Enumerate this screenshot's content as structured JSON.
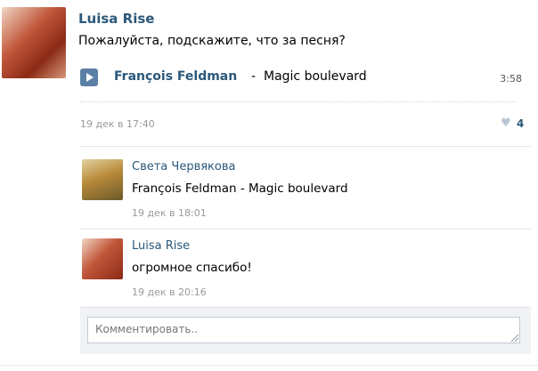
{
  "post": {
    "author": "Luisa Rise",
    "text": "Пожалуйста, подскажите, что за песня?",
    "audio": {
      "artist": "François Feldman",
      "separator": "-",
      "title": "Magic boulevard",
      "duration": "3:58"
    },
    "date": "19 дек в 17:40",
    "likes": "4"
  },
  "comments": [
    {
      "author": "Света Червякова",
      "text": "François Feldman - Magic boulevard",
      "date": "19 дек в 18:01"
    },
    {
      "author": "Luisa Rise",
      "text": "огромное спасибо!",
      "date": "19 дек в 20:16"
    }
  ],
  "comment_form": {
    "placeholder": "Комментировать.."
  },
  "icons": {
    "play": "play-icon",
    "like": "heart-icon"
  },
  "colors": {
    "link": "#2b587a",
    "muted": "#999999",
    "play_button": "#5b7fa5"
  }
}
